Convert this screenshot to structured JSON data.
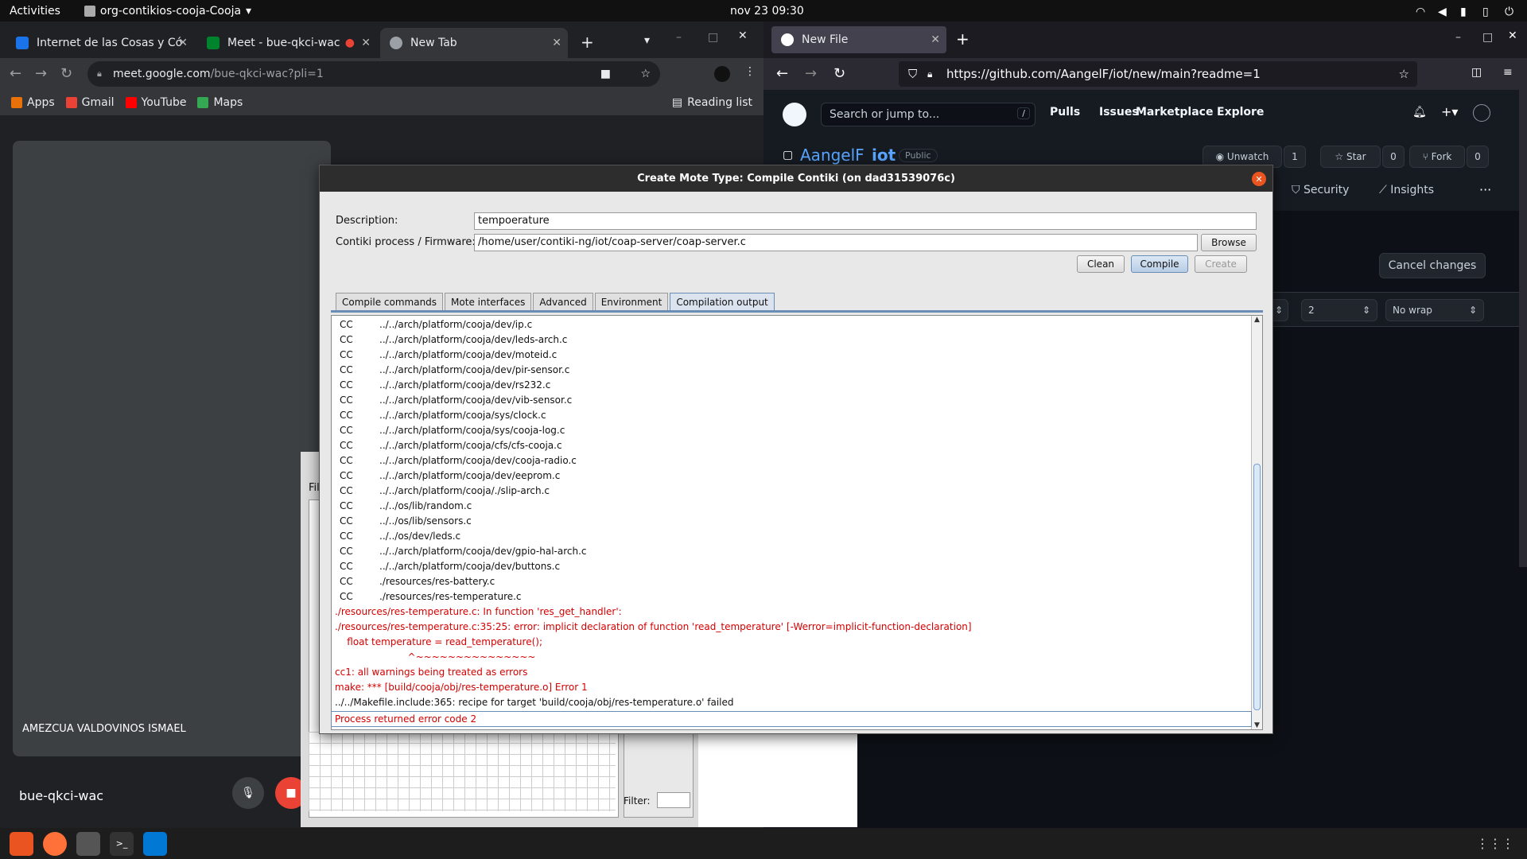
{
  "topbar": {
    "activities": "Activities",
    "app_name": "org-contikios-cooja-Cooja",
    "clock": "nov 23  09:30"
  },
  "chrome": {
    "tabs": [
      {
        "label": "Internet de las Cosas y Có",
        "fav_color": "#1a73e8"
      },
      {
        "label": "Meet - bue-qkci-wac",
        "fav_color": "#00832d"
      },
      {
        "label": "New Tab",
        "fav_color": "#9aa0a6"
      }
    ],
    "url_host": "meet.google.com",
    "url_path": "/bue-qkci-wac?pli=1",
    "bookmarks": [
      {
        "label": "Apps",
        "color": "#e8710a"
      },
      {
        "label": "Gmail",
        "color": "#ea4335"
      },
      {
        "label": "YouTube",
        "color": "#ff0000"
      },
      {
        "label": "Maps",
        "color": "#34a853"
      }
    ],
    "reading_list": "Reading list",
    "meet": {
      "participant": "AMEZCUA VALDOVINOS ISMAEL",
      "meeting_code": "bue-qkci-wac"
    }
  },
  "firefox": {
    "tab_label": "New File",
    "url": "https://github.com/AangelF/iot/new/main?readme=1",
    "github": {
      "search_placeholder": "Search or jump to...",
      "search_key": "/",
      "nav": [
        "Pulls",
        "Issues",
        "Marketplace",
        "Explore"
      ],
      "repo_owner": "AangelF",
      "repo_name": "iot",
      "visibility": "Public",
      "unwatch": "Unwatch",
      "watch_count": "1",
      "star": "Star",
      "star_count": "0",
      "fork": "Fork",
      "fork_count": "0",
      "security": "Security",
      "insights": "Insights",
      "cancel_changes": "Cancel changes",
      "indent_size": "2",
      "wrap_mode": "No wrap"
    }
  },
  "cooja_bg": {
    "menu_file": "Fil",
    "filter_label": "Filter:"
  },
  "dialog": {
    "title": "Create Mote Type: Compile Contiki (on dad31539076c)",
    "description_label": "Description:",
    "description_value": "tempoerature",
    "firmware_label": "Contiki process / Firmware:",
    "firmware_value": "/home/user/contiki-ng/iot/coap-server/coap-server.c",
    "browse": "Browse",
    "clean": "Clean",
    "compile": "Compile",
    "create": "Create",
    "tabs": [
      "Compile commands",
      "Mote interfaces",
      "Advanced",
      "Environment",
      "Compilation output"
    ],
    "output": [
      {
        "cc": "CC",
        "text": "../../arch/platform/cooja/dev/ip.c",
        "err": false
      },
      {
        "cc": "CC",
        "text": "../../arch/platform/cooja/dev/leds-arch.c",
        "err": false
      },
      {
        "cc": "CC",
        "text": "../../arch/platform/cooja/dev/moteid.c",
        "err": false
      },
      {
        "cc": "CC",
        "text": "../../arch/platform/cooja/dev/pir-sensor.c",
        "err": false
      },
      {
        "cc": "CC",
        "text": "../../arch/platform/cooja/dev/rs232.c",
        "err": false
      },
      {
        "cc": "CC",
        "text": "../../arch/platform/cooja/dev/vib-sensor.c",
        "err": false
      },
      {
        "cc": "CC",
        "text": "../../arch/platform/cooja/sys/clock.c",
        "err": false
      },
      {
        "cc": "CC",
        "text": "../../arch/platform/cooja/sys/cooja-log.c",
        "err": false
      },
      {
        "cc": "CC",
        "text": "../../arch/platform/cooja/cfs/cfs-cooja.c",
        "err": false
      },
      {
        "cc": "CC",
        "text": "../../arch/platform/cooja/dev/cooja-radio.c",
        "err": false
      },
      {
        "cc": "CC",
        "text": "../../arch/platform/cooja/dev/eeprom.c",
        "err": false
      },
      {
        "cc": "CC",
        "text": "../../arch/platform/cooja/./slip-arch.c",
        "err": false
      },
      {
        "cc": "CC",
        "text": "../../os/lib/random.c",
        "err": false
      },
      {
        "cc": "CC",
        "text": "../../os/lib/sensors.c",
        "err": false
      },
      {
        "cc": "CC",
        "text": "../../os/dev/leds.c",
        "err": false
      },
      {
        "cc": "CC",
        "text": "../../arch/platform/cooja/dev/gpio-hal-arch.c",
        "err": false
      },
      {
        "cc": "CC",
        "text": "../../arch/platform/cooja/dev/buttons.c",
        "err": false
      },
      {
        "cc": "CC",
        "text": "./resources/res-battery.c",
        "err": false
      },
      {
        "cc": "CC",
        "text": "./resources/res-temperature.c",
        "err": false
      },
      {
        "cc": "",
        "text": "./resources/res-temperature.c: In function 'res_get_handler':",
        "err": true
      },
      {
        "cc": "",
        "text": "./resources/res-temperature.c:35:25: error: implicit declaration of function 'read_temperature' [-Werror=implicit-function-declaration]",
        "err": true
      },
      {
        "cc": "",
        "text": "    float temperature = read_temperature();",
        "err": true
      },
      {
        "cc": "",
        "text": "                        ^~~~~~~~~~~~~~~~",
        "err": true
      },
      {
        "cc": "",
        "text": "cc1: all warnings being treated as errors",
        "err": true
      },
      {
        "cc": "",
        "text": "make: *** [build/cooja/obj/res-temperature.o] Error 1",
        "err": true
      },
      {
        "cc": "",
        "text": "../../Makefile.include:365: recipe for target 'build/cooja/obj/res-temperature.o' failed",
        "err": false
      }
    ],
    "process_status": "Process returned error code 2"
  }
}
